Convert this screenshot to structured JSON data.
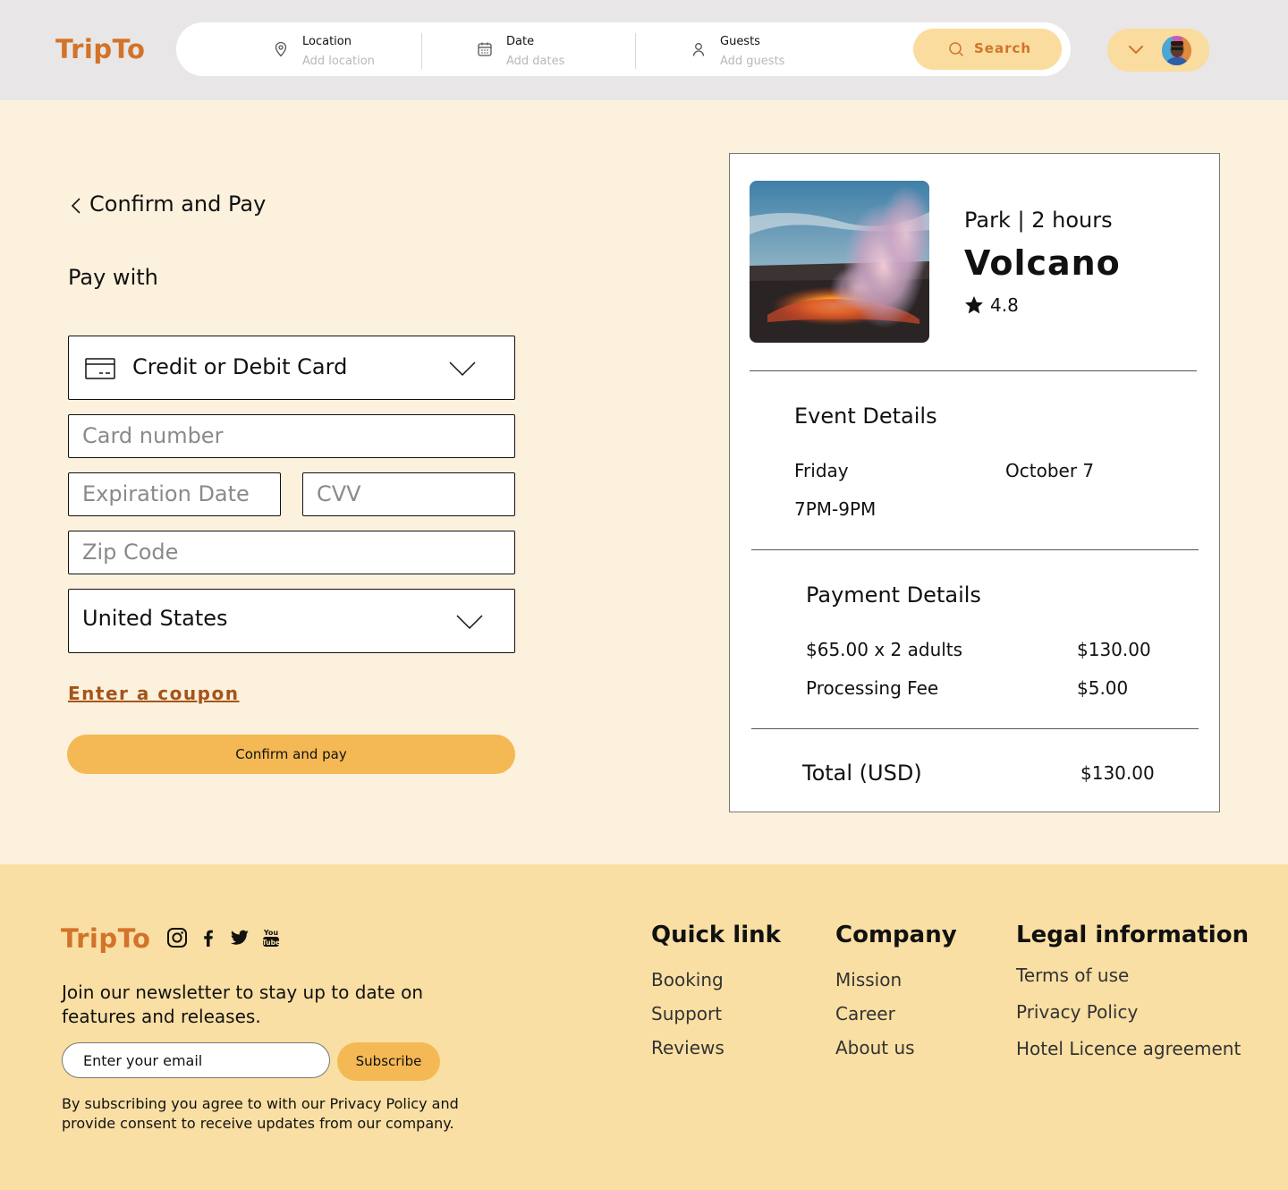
{
  "header": {
    "logo": "TripTo",
    "location_label": "Location",
    "location_placeholder": "Add location",
    "date_label": "Date",
    "date_placeholder": "Add dates",
    "guests_label": "Guests",
    "guests_placeholder": "Add guests",
    "search_label": "Search"
  },
  "checkout": {
    "title": "Confirm and Pay",
    "pay_with": "Pay with",
    "payment_method": "Credit or Debit Card",
    "card_number_placeholder": "Card number",
    "expiration_placeholder": "Expiration Date",
    "cvv_placeholder": "CVV",
    "zip_placeholder": "Zip Code",
    "country": "United States",
    "coupon_link": "Enter a coupon",
    "confirm_button": "Confirm and pay"
  },
  "summary": {
    "meta": "Park | 2 hours",
    "name": "Volcano",
    "rating": "4.8",
    "event_details_title": "Event Details",
    "day": "Friday",
    "date": "October 7",
    "time": "7PM-9PM",
    "payment_details_title": "Payment Details",
    "line_items": [
      {
        "label": "$65.00 x 2 adults",
        "amount": "$130.00"
      },
      {
        "label": "Processing Fee",
        "amount": "$5.00"
      }
    ],
    "total_label": "Total (USD)",
    "total_amount": "$130.00"
  },
  "footer": {
    "logo": "TripTo",
    "newsletter": "Join our newsletter to stay up to date on features and releases.",
    "email_placeholder": "Enter your email",
    "subscribe_button": "Subscribe",
    "consent": "By subscribing you agree to with our Privacy Policy and provide consent to receive updates from our company.",
    "quick_link_title": "Quick link",
    "quick_links": [
      "Booking",
      "Support",
      "Reviews"
    ],
    "company_title": "Company",
    "company_links": [
      "Mission",
      "Career",
      "About us"
    ],
    "legal_title": "Legal information",
    "legal_links": [
      "Terms of use",
      "Privacy Policy",
      "Hotel Licence agreement"
    ],
    "social_icons": [
      "instagram-icon",
      "facebook-icon",
      "twitter-icon",
      "youtube-icon"
    ]
  },
  "colors": {
    "brand": "#d2732a",
    "accent": "#f4b954",
    "header_bg": "#e8e6e6",
    "page_bg": "#fcf1dc",
    "footer_bg": "#f9dfa3",
    "coupon": "#a3551b"
  }
}
